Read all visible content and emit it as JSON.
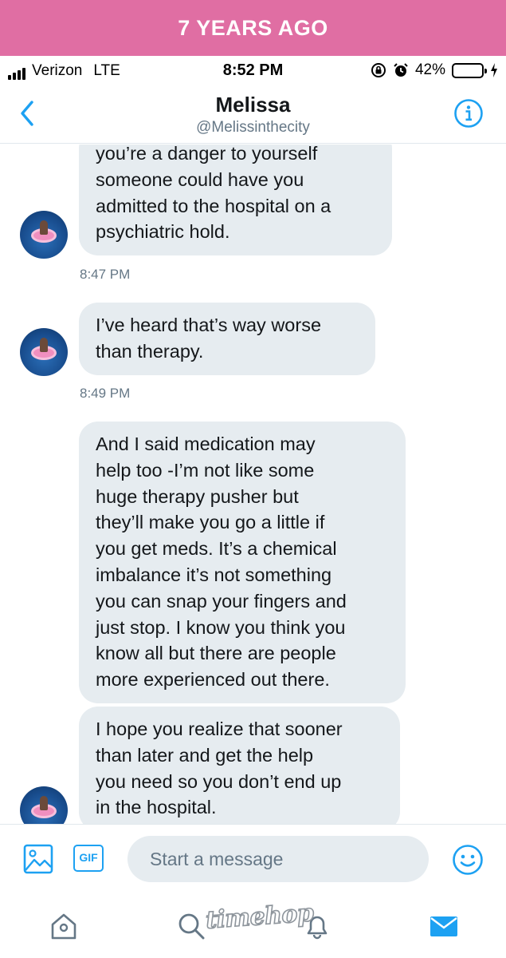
{
  "banner": {
    "text": "7 YEARS AGO",
    "color": "#e06ea3"
  },
  "status_bar": {
    "carrier": "Verizon",
    "network": "LTE",
    "time": "8:52 PM",
    "battery_percent": "42%",
    "battery_level": 0.42,
    "icons": [
      "signal-bars-icon",
      "rotation-lock-icon",
      "alarm-icon",
      "battery-icon",
      "charging-bolt-icon"
    ]
  },
  "header": {
    "back_icon": "chevron-left-icon",
    "name": "Melissa",
    "handle": "@Melissinthecity",
    "info_icon": "info-icon"
  },
  "messages": [
    {
      "text": "you’re a danger to yourself someone could have you admitted to the hospital on a psychiatric hold.",
      "lines": [
        "you’re a danger to yourself",
        "someone could have you",
        "admitted to the hospital on a",
        "psychiatric hold."
      ],
      "timestamp": "8:47 PM"
    },
    {
      "text": "I’ve heard that’s way worse than therapy.",
      "lines": [
        "I’ve heard that’s way worse",
        "than therapy."
      ],
      "timestamp": "8:49 PM"
    },
    {
      "text": "And I said medication may help too -I’m not like some huge therapy pusher but they’ll make you go a little if you get meds. It’s a chemical imbalance it’s not something you can snap your fingers and just stop. I know you think you know all but there are people more experienced out there.",
      "lines": [
        "And I said medication may",
        "help too -I’m not like some",
        "huge therapy pusher but",
        "they’ll make you go a little if",
        "you get meds. It’s a chemical",
        "imbalance it’s not something",
        "you can snap your fingers and",
        "just stop. I know you think you",
        "know all but there are people",
        "more experienced out there."
      ],
      "timestamp": ""
    },
    {
      "text": "I hope you realize that sooner than later and get the help you need so you don’t end up in the hospital.",
      "lines": [
        "I hope you realize that sooner",
        "than later and get the help",
        "you need so you don’t end up",
        "in the hospital."
      ],
      "timestamp": ""
    }
  ],
  "composer": {
    "placeholder": "Start a message",
    "photo_icon": "image-icon",
    "gif_label": "GIF",
    "emoji_icon": "emoji-icon"
  },
  "tab_bar": {
    "icons": [
      "home-icon",
      "search-icon",
      "bell-icon",
      "mail-icon"
    ],
    "active": "mail-icon",
    "watermark": "timehop"
  },
  "colors": {
    "accent": "#1da1f2",
    "bubble": "#e6ecf0",
    "muted": "#657786"
  }
}
